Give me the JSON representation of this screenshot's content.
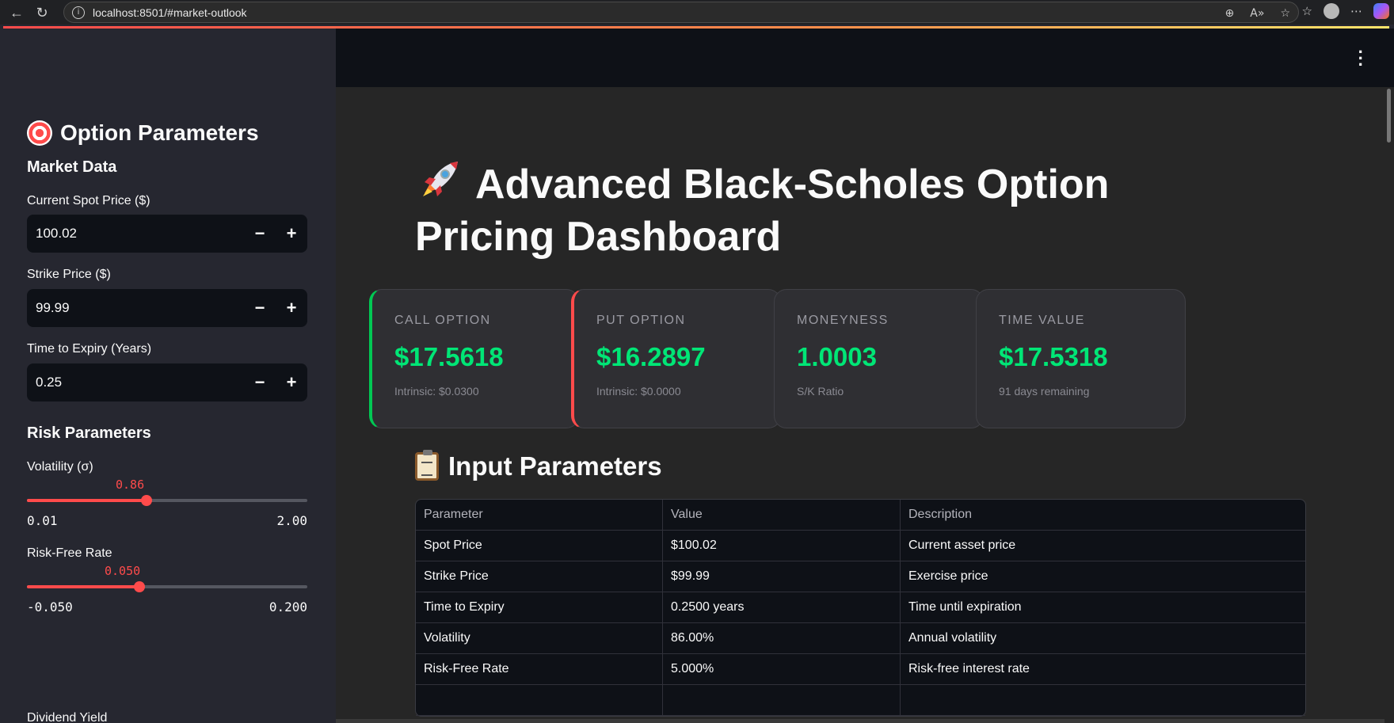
{
  "browser": {
    "url": "localhost:8501/#market-outlook"
  },
  "sidebar": {
    "title": "Option Parameters",
    "market_section": "Market Data",
    "spot": {
      "label": "Current Spot Price ($)",
      "value": "100.02"
    },
    "strike": {
      "label": "Strike Price ($)",
      "value": "99.99"
    },
    "expiry": {
      "label": "Time to Expiry (Years)",
      "value": "0.25"
    },
    "stepper": {
      "minus": "−",
      "plus": "+"
    },
    "risk_section": "Risk Parameters",
    "volatility": {
      "label": "Volatility (σ)",
      "value": "0.86",
      "min": "0.01",
      "max": "2.00",
      "fraction": 0.427
    },
    "risk_free": {
      "label": "Risk-Free Rate",
      "value": "0.050",
      "min": "-0.050",
      "max": "0.200",
      "fraction": 0.4
    },
    "dividend_label": "Dividend Yield"
  },
  "main": {
    "title": "Advanced Black-Scholes Option Pricing Dashboard",
    "metrics": [
      {
        "label": "CALL OPTION",
        "value": "$17.5618",
        "sub": "Intrinsic: $0.0300"
      },
      {
        "label": "PUT OPTION",
        "value": "$16.2897",
        "sub": "Intrinsic: $0.0000"
      },
      {
        "label": "MONEYNESS",
        "value": "1.0003",
        "sub": "S/K Ratio"
      },
      {
        "label": "TIME VALUE",
        "value": "$17.5318",
        "sub": "91 days remaining"
      }
    ],
    "params_title": "Input Parameters",
    "table": {
      "headers": [
        "Parameter",
        "Value",
        "Description"
      ],
      "rows": [
        [
          "Spot Price",
          "$100.02",
          "Current asset price"
        ],
        [
          "Strike Price",
          "$99.99",
          "Exercise price"
        ],
        [
          "Time to Expiry",
          "0.2500 years",
          "Time until expiration"
        ],
        [
          "Volatility",
          "86.00%",
          "Annual volatility"
        ],
        [
          "Risk-Free Rate",
          "5.000%",
          "Risk-free interest rate"
        ]
      ]
    }
  },
  "colors": {
    "accent": "#ff4b4b",
    "positive": "#00e676",
    "sidebar_bg": "#262730",
    "main_bg": "#262626"
  }
}
